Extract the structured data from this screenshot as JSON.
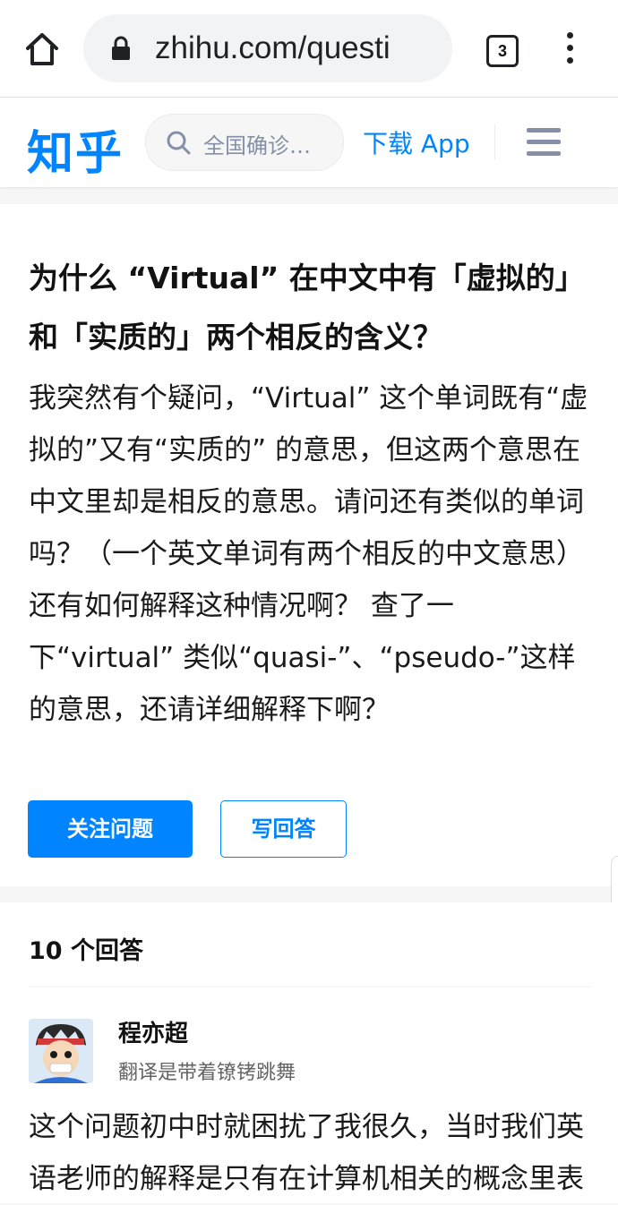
{
  "browser": {
    "url": "zhihu.com/questi",
    "tab_count": "3"
  },
  "header": {
    "logo": "知乎",
    "search_placeholder": "全国确诊…",
    "download_label": "下载 App"
  },
  "question": {
    "title": "为什么 “Virtual” 在中文中有「虚拟的」和「实质的」两个相反的含义？",
    "body": "我突然有个疑问，“Virtual” 这个单词既有“虚拟的”又有“实质的” 的意思，但这两个意思在中文里却是相反的意思。请问还有类似的单词吗？（一个英文单词有两个相反的中文意思） 还有如何解释这种情况啊？ 查了一下“virtual” 类似“quasi-”、“pseudo-”这样的意思，还请详细解释下啊？",
    "follow_label": "关注问题",
    "answer_label": "写回答"
  },
  "answers": {
    "count_label": "10 个回答",
    "first": {
      "author": "程亦超",
      "bio": "翻译是带着镣铐跳舞",
      "excerpt": "这个问题初中时就困扰了我很久，当时我们英语老师的解释是只有在计算机相关的概念里表"
    }
  },
  "colors": {
    "accent": "#0084ff",
    "page_bg": "#f6f6f6"
  }
}
